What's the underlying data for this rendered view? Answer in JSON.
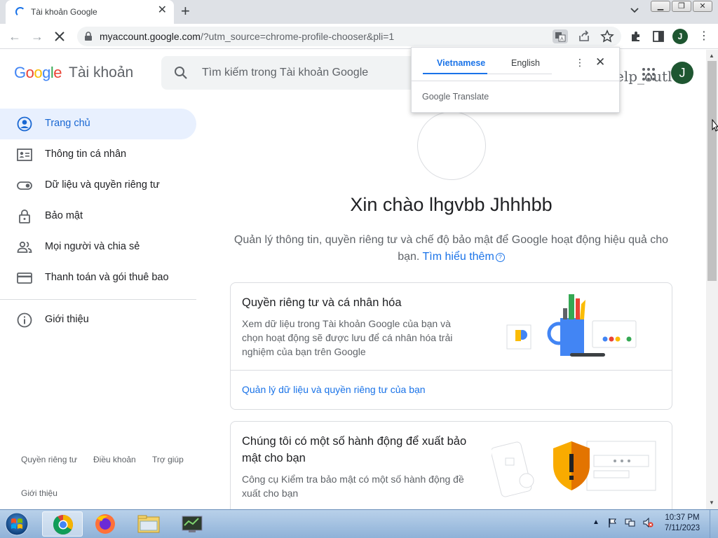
{
  "browser": {
    "tab": {
      "title": "Tài khoản Google"
    },
    "url": {
      "host": "myaccount.google.com",
      "path": "/?utm_source=chrome-profile-chooser&pli=1"
    },
    "profile_initial": "J"
  },
  "translate_popup": {
    "tabs": [
      "Vietnamese",
      "English"
    ],
    "brand_google": "Google",
    "brand_translate": "Translate"
  },
  "header": {
    "logo_letters": [
      "G",
      "o",
      "o",
      "g",
      "l",
      "e"
    ],
    "logo_colors": [
      "#4285f4",
      "#ea4335",
      "#fbbc05",
      "#4285f4",
      "#34a853",
      "#ea4335"
    ],
    "product": "Tài khoản",
    "search_placeholder": "Tìm kiếm trong Tài khoản Google",
    "garbled_text": "elp_outl",
    "avatar_initial": "J"
  },
  "sidebar": {
    "items": [
      {
        "label": "Trang chủ",
        "icon": "account-circle-icon"
      },
      {
        "label": "Thông tin cá nhân",
        "icon": "id-card-icon"
      },
      {
        "label": "Dữ liệu và quyền riêng tư",
        "icon": "toggle-icon"
      },
      {
        "label": "Bảo mật",
        "icon": "lock-icon"
      },
      {
        "label": "Mọi người và chia sẻ",
        "icon": "people-icon"
      },
      {
        "label": "Thanh toán và gói thuê bao",
        "icon": "credit-card-icon"
      },
      {
        "label": "Giới thiệu",
        "icon": "info-icon"
      }
    ],
    "footer": [
      "Quyền riêng tư",
      "Điều khoản",
      "Trợ giúp",
      "Giới thiệu"
    ]
  },
  "main": {
    "greeting": "Xin chào lhgvbb Jhhhbb",
    "subtitle": "Quản lý thông tin, quyền riêng tư và chế độ bảo mật để Google hoạt động hiệu quả cho bạn.",
    "learn_more": "Tìm hiểu thêm",
    "cards": [
      {
        "title": "Quyền riêng tư và cá nhân hóa",
        "description_lines": [
          "Xem dữ liệu trong Tài khoản Google của bạn và",
          "chọn hoạt động sẽ được lưu để cá nhân hóa trải",
          "nghiệm của bạn trên Google"
        ],
        "link": "Quản lý dữ liệu và quyền riêng tư của bạn"
      },
      {
        "title_lines": [
          "Chúng tôi có một số hành động để xuất bảo",
          "mật cho bạn"
        ],
        "description_lines": [
          "Công cụ Kiểm tra bảo mật có một số hành động đề",
          "xuất cho bạn"
        ]
      }
    ]
  },
  "taskbar": {
    "time": "10:37 PM",
    "date": "7/11/2023"
  }
}
